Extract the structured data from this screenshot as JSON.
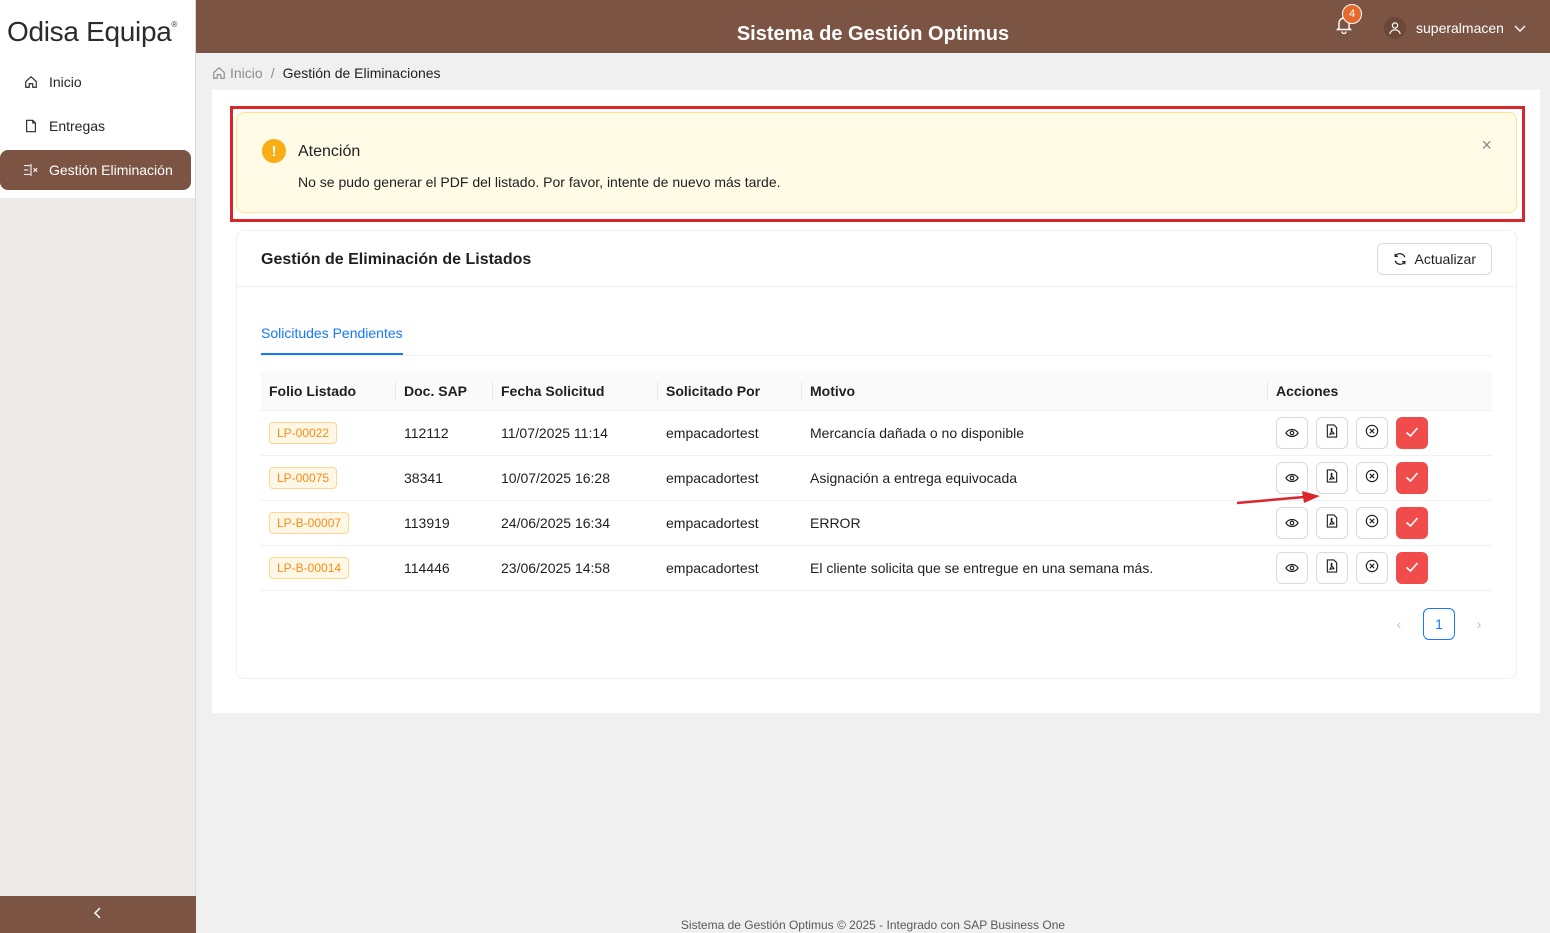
{
  "logo": {
    "text": "Odisa Equipa",
    "mark": "®"
  },
  "sidebar": {
    "items": [
      {
        "label": "Inicio",
        "icon": "home-icon"
      },
      {
        "label": "Entregas",
        "icon": "file-icon"
      },
      {
        "label": "Gestión Eliminación",
        "icon": "delete-list-icon",
        "active": true
      }
    ],
    "collapse_icon": "chevron-left-icon"
  },
  "header": {
    "title": "Sistema de Gestión Optimus",
    "notifications_count": "4",
    "username": "superalmacen"
  },
  "breadcrumb": {
    "home": "Inicio",
    "separator": "/",
    "current": "Gestión de Eliminaciones"
  },
  "alert": {
    "title": "Atención",
    "message": "No se pudo generar el PDF del listado. Por favor, intente de nuevo más tarde.",
    "icon_glyph": "!",
    "close_glyph": "×"
  },
  "card": {
    "title": "Gestión de Eliminación de Listados",
    "refresh_label": "Actualizar",
    "tab_label": "Solicitudes Pendientes"
  },
  "table": {
    "headers": [
      "Folio Listado",
      "Doc. SAP",
      "Fecha Solicitud",
      "Solicitado Por",
      "Motivo",
      "Acciones"
    ],
    "rows": [
      {
        "folio": "LP-00022",
        "doc": "112112",
        "fecha": "11/07/2025 11:14",
        "por": "empacadortest",
        "motivo": "Mercancía dañada o no disponible"
      },
      {
        "folio": "LP-00075",
        "doc": "38341",
        "fecha": "10/07/2025 16:28",
        "por": "empacadortest",
        "motivo": "Asignación a entrega equivocada"
      },
      {
        "folio": "LP-B-00007",
        "doc": "113919",
        "fecha": "24/06/2025 16:34",
        "por": "empacadortest",
        "motivo": "ERROR"
      },
      {
        "folio": "LP-B-00014",
        "doc": "114446",
        "fecha": "23/06/2025 14:58",
        "por": "empacadortest",
        "motivo": "El cliente solicita que se entregue en una semana más."
      }
    ]
  },
  "pagination": {
    "current": "1",
    "prev": "‹",
    "next": "›"
  },
  "footer": {
    "text": "Sistema de Gestión Optimus © 2025 - Integrado con SAP Business One"
  },
  "colors": {
    "brand": "#7b5443",
    "accent": "#1677ff",
    "danger": "#f04c4c",
    "warning": "#faad14"
  }
}
